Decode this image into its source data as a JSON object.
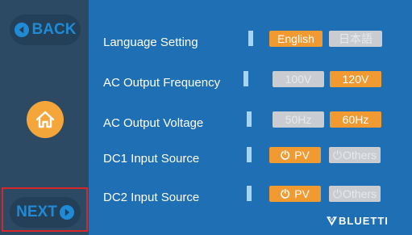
{
  "sidebar": {
    "back_label": "BACK",
    "next_label": "NEXT",
    "home_icon": "home-icon",
    "back_icon": "left-arrow-circle-icon",
    "next_icon": "right-arrow-circle-icon"
  },
  "settings": [
    {
      "label": "Language Setting",
      "options": [
        {
          "label": "English",
          "selected": true
        },
        {
          "label": "日本語",
          "selected": false
        }
      ]
    },
    {
      "label": "AC Output Frequency",
      "options": [
        {
          "label": "100V",
          "selected": false
        },
        {
          "label": "120V",
          "selected": true
        }
      ]
    },
    {
      "label": "AC Output Voltage",
      "options": [
        {
          "label": "50Hz",
          "selected": false
        },
        {
          "label": "60Hz",
          "selected": true
        }
      ]
    },
    {
      "label": "DC1 Input Source",
      "options": [
        {
          "icon": "power-icon",
          "label": "PV",
          "selected": true
        },
        {
          "icon": "power-icon",
          "label": "Others",
          "selected": false
        }
      ]
    },
    {
      "label": "DC2 Input Source",
      "options": [
        {
          "icon": "power-icon",
          "label": "PV",
          "selected": true
        },
        {
          "icon": "power-icon",
          "label": "Others",
          "selected": false
        }
      ]
    }
  ],
  "power_glyph": "⏻",
  "brand": {
    "name": "BLUETTI"
  },
  "colors": {
    "background": "#1f6fb4",
    "sidebar": "#2c4a63",
    "accent": "#f19a32",
    "inactive": "#c9ccd0",
    "nav_text": "#1f8ad6",
    "highlight": "#d8272a"
  }
}
